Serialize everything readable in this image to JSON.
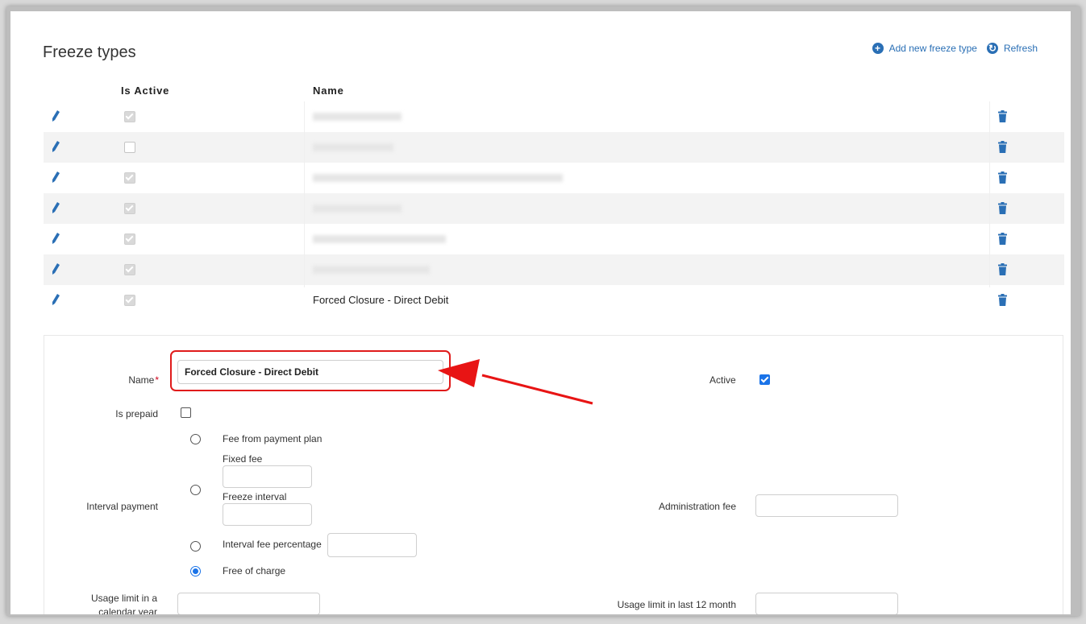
{
  "page": {
    "title": "Freeze types",
    "add_new_label": "Add new freeze type",
    "refresh_label": "Refresh"
  },
  "table": {
    "headers": {
      "is_active": "Is Active",
      "name": "Name"
    },
    "rows": [
      {
        "active": true,
        "name": ""
      },
      {
        "active": false,
        "name": ""
      },
      {
        "active": true,
        "name": ""
      },
      {
        "active": true,
        "name": ""
      },
      {
        "active": true,
        "name": ""
      },
      {
        "active": true,
        "name": ""
      },
      {
        "active": true,
        "name": "Forced Closure - Direct Debit"
      }
    ]
  },
  "form": {
    "name_label": "Name",
    "name_value": "Forced Closure - Direct Debit",
    "active_label": "Active",
    "active_checked": true,
    "is_prepaid_label": "Is prepaid",
    "is_prepaid_checked": false,
    "interval_payment_label": "Interval payment",
    "options": {
      "fee_from_plan": "Fee from payment plan",
      "fixed_fee": "Fixed fee",
      "freeze_interval": "Freeze interval",
      "interval_fee_percentage": "Interval fee percentage",
      "free_of_charge": "Free of charge"
    },
    "selected_option": "free_of_charge",
    "administration_fee_label": "Administration fee",
    "usage_limit_calendar_label": "Usage limit in a calendar year",
    "usage_limit_12_label": "Usage limit in last 12 month"
  },
  "colors": {
    "accent": "#1a73e8",
    "link": "#2a6fb5",
    "highlight": "#e01b1b"
  }
}
